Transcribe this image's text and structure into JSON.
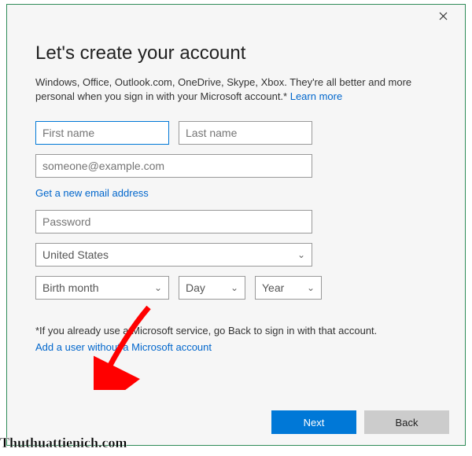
{
  "title": "Let's create your account",
  "intro_text": "Windows, Office, Outlook.com, OneDrive, Skype, Xbox. They're all better and more personal when you sign in with your Microsoft account.* ",
  "learn_more": "Learn more",
  "fields": {
    "first_name_placeholder": "First name",
    "last_name_placeholder": "Last name",
    "email_placeholder": "someone@example.com",
    "password_placeholder": "Password",
    "country_value": "United States",
    "birth_month_value": "Birth month",
    "day_value": "Day",
    "year_value": "Year"
  },
  "get_email_link": "Get a new email address",
  "footnote": "*If you already use a Microsoft service, go Back to sign in with that account.",
  "add_user_link": "Add a user without a Microsoft account",
  "buttons": {
    "next": "Next",
    "back": "Back"
  },
  "watermark": "Thuthuattienich.com"
}
